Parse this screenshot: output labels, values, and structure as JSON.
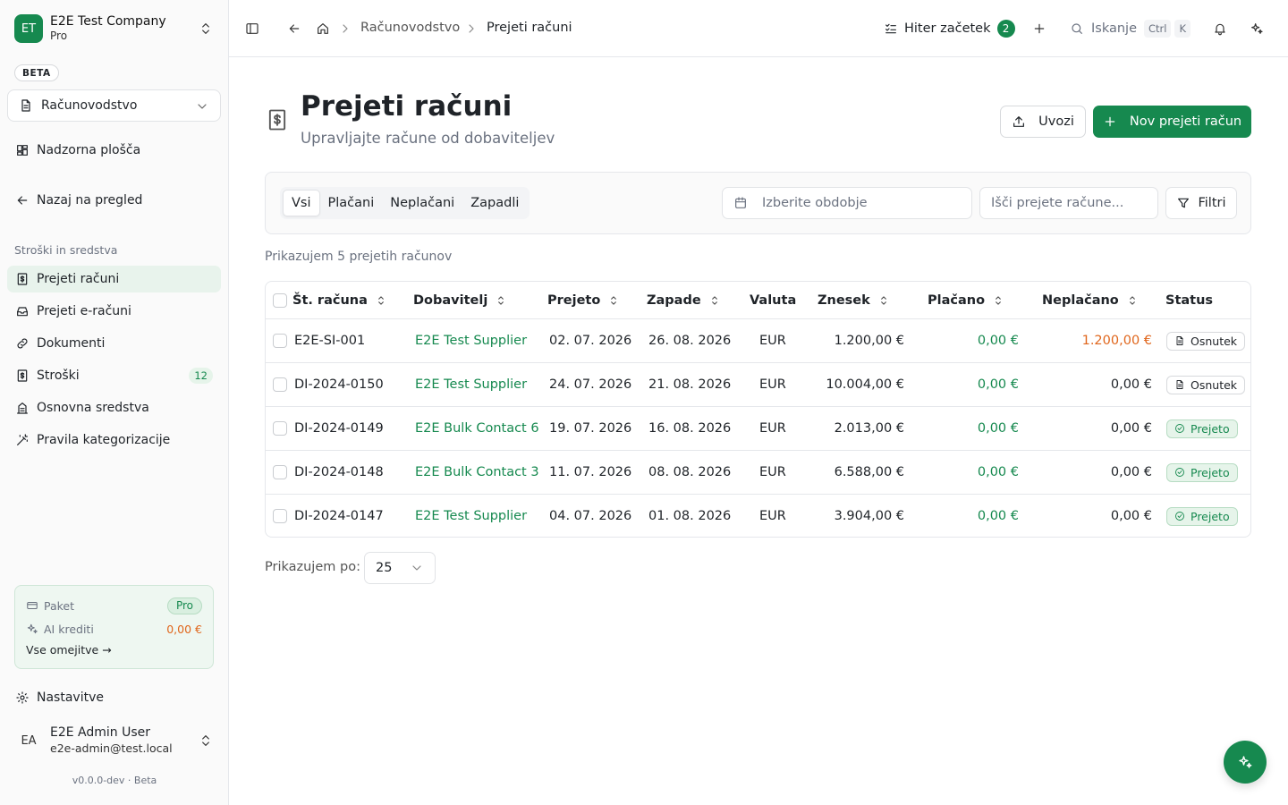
{
  "company": {
    "initials": "ET",
    "name": "E2E Test Company",
    "plan": "Pro"
  },
  "sidebar": {
    "beta_badge": "BETA",
    "section_select": "Računovodstvo",
    "dashboard": "Nadzorna plošča",
    "back": "Nazaj na pregled",
    "group_label": "Stroški in sredstva",
    "items": [
      {
        "label": "Prejeti računi",
        "icon": "receipt-icon",
        "active": true
      },
      {
        "label": "Prejeti e-računi",
        "icon": "inbox-icon"
      },
      {
        "label": "Dokumenti",
        "icon": "link-icon"
      },
      {
        "label": "Stroški",
        "icon": "receipt-icon",
        "count": "12"
      },
      {
        "label": "Osnovna sredstva",
        "icon": "building-icon"
      },
      {
        "label": "Pravila kategorizacije",
        "icon": "magic-wand-icon"
      }
    ],
    "plan_card": {
      "plan_label": "Paket",
      "plan_value": "Pro",
      "credits_label": "AI krediti",
      "credits_value": "0,00 €",
      "link": "Vse omejitve →"
    },
    "settings": "Nastavitve",
    "user": {
      "initials": "EA",
      "name": "E2E Admin User",
      "email": "e2e-admin@test.local"
    },
    "version": "v0.0.0-dev · Beta"
  },
  "topbar": {
    "breadcrumb": [
      "Računovodstvo",
      "Prejeti računi"
    ],
    "quick_start": {
      "label": "Hiter začetek",
      "badge": "2"
    },
    "search": {
      "label": "Iskanje",
      "kbd1": "Ctrl",
      "kbd2": "K"
    }
  },
  "page": {
    "title": "Prejeti računi",
    "subtitle": "Upravljajte račune od dobaviteljev",
    "import_label": "Uvozi",
    "new_label": "Nov prejeti račun"
  },
  "filters": {
    "tabs": [
      "Vsi",
      "Plačani",
      "Neplačani",
      "Zapadli"
    ],
    "active_tab": "Vsi",
    "date_placeholder": "Izberite obdobje",
    "search_placeholder": "Išči prejete račune...",
    "filters_label": "Filtri"
  },
  "count_text": "Prikazujem 5 prejetih računov",
  "table": {
    "columns": {
      "number": "Št. računa",
      "supplier": "Dobavitelj",
      "received": "Prejeto",
      "due": "Zapade",
      "currency": "Valuta",
      "amount": "Znesek",
      "paid": "Plačano",
      "unpaid": "Neplačano",
      "status": "Status"
    },
    "rows": [
      {
        "number": "E2E-SI-001",
        "supplier": "E2E Test Supplier",
        "received": "02. 07. 2026",
        "due": "26. 08. 2026",
        "currency": "EUR",
        "amount": "1.200,00 €",
        "paid": "0,00 €",
        "unpaid": "1.200,00 €",
        "status": "Osnutek"
      },
      {
        "number": "DI-2024-0150",
        "supplier": "E2E Test Supplier",
        "received": "24. 07. 2026",
        "due": "21. 08. 2026",
        "currency": "EUR",
        "amount": "10.004,00 €",
        "paid": "0,00 €",
        "unpaid": "0,00 €",
        "status": "Osnutek"
      },
      {
        "number": "DI-2024-0149",
        "supplier": "E2E Bulk Contact 6",
        "received": "19. 07. 2026",
        "due": "16. 08. 2026",
        "currency": "EUR",
        "amount": "2.013,00 €",
        "paid": "0,00 €",
        "unpaid": "0,00 €",
        "status": "Prejeto"
      },
      {
        "number": "DI-2024-0148",
        "supplier": "E2E Bulk Contact 3",
        "received": "11. 07. 2026",
        "due": "08. 08. 2026",
        "currency": "EUR",
        "amount": "6.588,00 €",
        "paid": "0,00 €",
        "unpaid": "0,00 €",
        "status": "Prejeto"
      },
      {
        "number": "DI-2024-0147",
        "supplier": "E2E Test Supplier",
        "received": "04. 07. 2026",
        "due": "01. 08. 2026",
        "currency": "EUR",
        "amount": "3.904,00 €",
        "paid": "0,00 €",
        "unpaid": "0,00 €",
        "status": "Prejeto"
      }
    ]
  },
  "pagination": {
    "per_page_label": "Prikazujem po:",
    "per_page_value": "25"
  },
  "colors": {
    "accent": "#16894f",
    "warning": "#e0661c",
    "muted": "#6b7280"
  }
}
